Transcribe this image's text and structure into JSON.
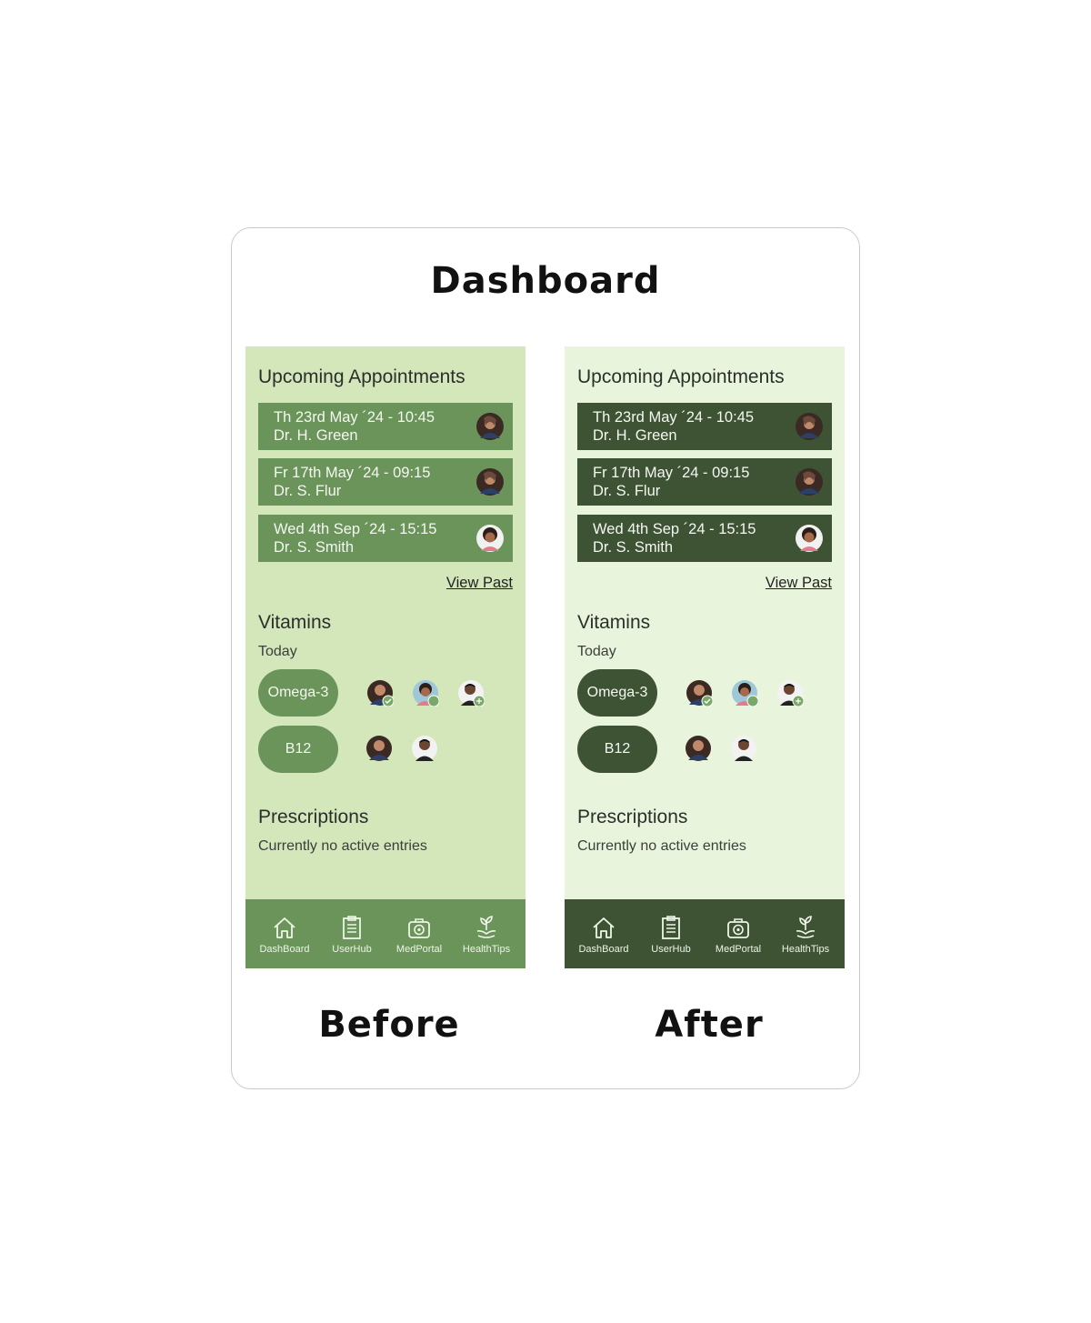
{
  "page_title": "Dashboard",
  "variants": [
    {
      "label": "Before",
      "theme": {
        "background": "#d3e7bb",
        "primary": "#6a945a"
      },
      "appointments_title": "Upcoming Appointments",
      "appointments": [
        {
          "date": "Th 23rd May ´24 - 10:45",
          "doctor": "Dr. H. Green",
          "avatar": "doctor-avatar-green"
        },
        {
          "date": "Fr 17th May ´24 - 09:15",
          "doctor": "Dr. S. Flur",
          "avatar": "doctor-avatar-flur"
        },
        {
          "date": "Wed 4th Sep ´24 - 15:15",
          "doctor": "Dr. S. Smith",
          "avatar": "doctor-avatar-smith"
        }
      ],
      "view_past": "View Past",
      "vitamins_title": "Vitamins",
      "vitamins_subtitle": "Today",
      "vitamins": [
        {
          "name": "Omega-3"
        },
        {
          "name": "B12"
        }
      ],
      "prescriptions_title": "Prescriptions",
      "prescriptions_text": "Currently no active entries",
      "nav": [
        "DashBoard",
        "UserHub",
        "MedPortal",
        "HealthTips"
      ]
    },
    {
      "label": "After",
      "theme": {
        "background": "#e9f4dd",
        "primary": "#3d5334"
      },
      "appointments_title": "Upcoming Appointments",
      "appointments": [
        {
          "date": "Th 23rd May ´24 - 10:45",
          "doctor": "Dr. H. Green",
          "avatar": "doctor-avatar-green"
        },
        {
          "date": "Fr 17th May ´24 - 09:15",
          "doctor": "Dr. S. Flur",
          "avatar": "doctor-avatar-flur"
        },
        {
          "date": "Wed 4th Sep ´24 - 15:15",
          "doctor": "Dr. S. Smith",
          "avatar": "doctor-avatar-smith"
        }
      ],
      "view_past": "View Past",
      "vitamins_title": "Vitamins",
      "vitamins_subtitle": "Today",
      "vitamins": [
        {
          "name": "Omega-3"
        },
        {
          "name": "B12"
        }
      ],
      "prescriptions_title": "Prescriptions",
      "prescriptions_text": "Currently no active entries",
      "nav": [
        "DashBoard",
        "UserHub",
        "MedPortal",
        "HealthTips"
      ]
    }
  ]
}
